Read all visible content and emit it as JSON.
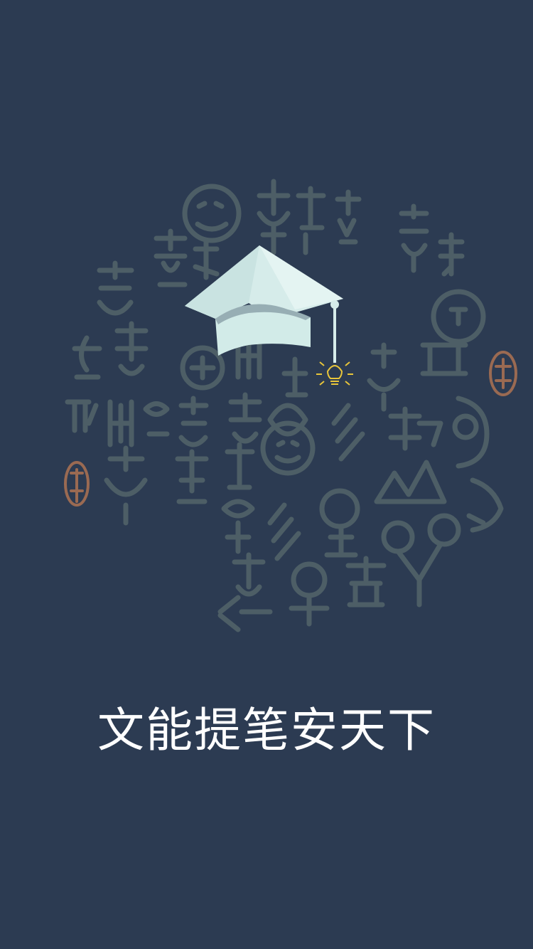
{
  "screen": {
    "background_color": "#2c3b52",
    "slogan": "文能提笔安天下"
  },
  "logo": {
    "icon": "graduation-cap-with-lightbulb-icon",
    "cap_color": "#d6ecea",
    "bulb_color": "#e8c53a"
  },
  "decoration": {
    "icon": "ancient-script-glyph-cloud",
    "glyph_color": "#4a5a62",
    "seal_color": "#9a6a52"
  }
}
